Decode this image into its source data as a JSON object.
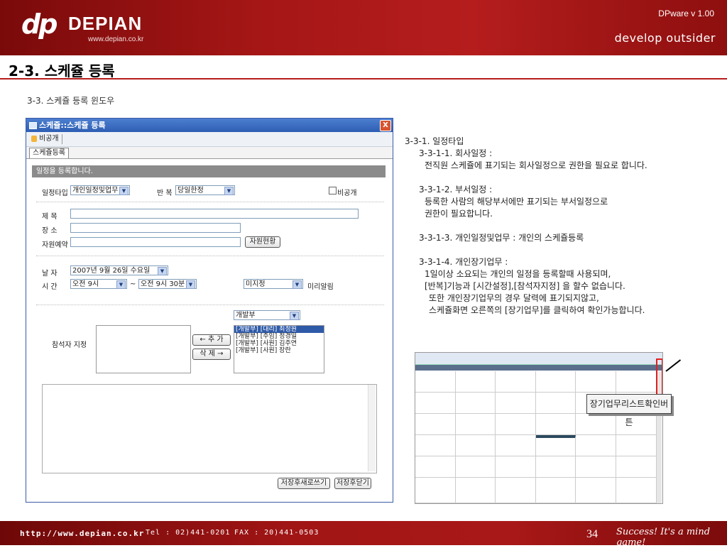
{
  "header": {
    "logo_mark": "dp",
    "logo_name": "DEPIAN",
    "logo_url": "www.depian.co.kr",
    "version": "DPware v 1.00",
    "tagline": "develop outsider"
  },
  "page_title": "2-3. 스케쥴 등록",
  "section_label": "3-3. 스케쥴 등록 윈도우",
  "window": {
    "title": "스케쥴::스케쥴 등록",
    "close_label": "X",
    "toolbar_private": "비공개",
    "tab_label": "스케쥴등록",
    "banner": "일정을 등록합니다.",
    "labels": {
      "type": "일정타입",
      "repeat": "반 복",
      "private": "비공개",
      "subject": "제 목",
      "place": "장 소",
      "resource": "자원예약",
      "date": "날 자",
      "time": "시 간",
      "tilde": "~",
      "reminder": "미리알림",
      "attendees": "참석자 지정"
    },
    "values": {
      "type": "개인일정및업무",
      "repeat": "당일한정",
      "date": "2007년  9월 26일 수요일",
      "time_start": "오전 9시",
      "time_end": "오전 9시 30분",
      "reminder": "미지정",
      "department": "개발부"
    },
    "buttons": {
      "resource_status": "자원현황",
      "add": "← 추 가",
      "remove": "삭 제 →",
      "save_new": "저장후새로쓰기",
      "save_close": "저장후닫기"
    },
    "attendee_candidates": [
      "[개발부] [대리] 최정원",
      "[개발부] [주임] 정경일",
      "[개발부] [사원] 김주연",
      "[개발부] [사원] 장란"
    ]
  },
  "description": {
    "lines": [
      "3-3-1. 일정타입",
      "3-3-1-1. 회사일정 :",
      "전직원 스케쥴에 표기되는 회사일정으로 권한을 필요로 합니다.",
      "3-3-1-2. 부서일정 :",
      "등록한 사람의 해당부서에만 표기되는 부서일정으로",
      "권한이 필요합니다.",
      "3-3-1-3. 개인일정및업무 : 개인의 스케쥴등록",
      "3-3-1-4. 개인장기업무 :",
      "1일이상 소요되는 개인의 일정을 등록할때 사용되며,",
      "[반복]기능과 [시간설정],[참석자지정] 을 할수 없습니다.",
      "또한 개인장기업무의 경우 달력에 표기되지않고,",
      "스케쥴화면 오른쪽의 [장기업무]를 클릭하여 확인가능합니다."
    ]
  },
  "callout": "장기업무리스트확인버튼",
  "footer": {
    "url": "http://www.depian.co.kr",
    "tel": "Tel : 02)441-0201",
    "fax": "FAX : 20)441-0503",
    "page_number": "34",
    "slogan": "Success! It's a mind game!"
  }
}
